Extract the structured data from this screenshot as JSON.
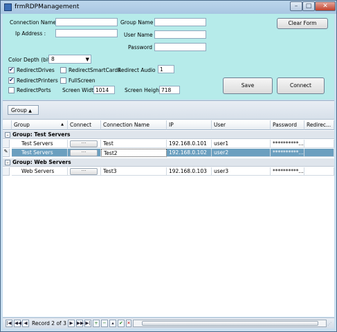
{
  "window": {
    "title": "frmRDPManagement",
    "min_label": "–",
    "max_label": "□",
    "close_label": "✕"
  },
  "form": {
    "connection_name": {
      "label": "Connection Name :",
      "value": ""
    },
    "ip_address": {
      "label": "Ip Address :",
      "value": ""
    },
    "group_name": {
      "label": "Group Name :",
      "value": ""
    },
    "user_name": {
      "label": "User Name :",
      "value": ""
    },
    "password": {
      "label": "Password :",
      "value": ""
    },
    "color_depth": {
      "label": "Color Depth (bit)",
      "value": "8"
    },
    "redirect_audio": {
      "label": "Redirect Audio",
      "value": "1"
    },
    "screen_width": {
      "label": "Screen Width",
      "value": "1014"
    },
    "screen_height": {
      "label": "Screen Height",
      "value": "718"
    },
    "checkboxes": {
      "redirect_drives": {
        "label": "RedirectDrives",
        "checked": true
      },
      "redirect_printers": {
        "label": "RedirectPrinters",
        "checked": true
      },
      "redirect_ports": {
        "label": "RedirectPorts",
        "checked": false
      },
      "redirect_smartcards": {
        "label": "RedirectSmartCards",
        "checked": false
      },
      "full_screen": {
        "label": "FullScreen",
        "checked": false
      }
    },
    "buttons": {
      "clear_form": "Clear Form",
      "save": "Save",
      "connect": "Connect"
    }
  },
  "grid": {
    "group_chip": "Group",
    "group_chip_arrow": "▲",
    "columns": [
      "Group",
      "Connect",
      "Connection Name",
      "IP",
      "User",
      "Password",
      "Redirec..."
    ],
    "sort_arrow": "▲",
    "connect_button_label": "···",
    "groups": [
      {
        "title": "Group: Test Servers",
        "rows": [
          {
            "group": "Test Servers",
            "connection_name": "Test",
            "ip": "192.168.0.101",
            "user": "user1",
            "password": "**********...",
            "selected": false
          },
          {
            "group": "Test Servers",
            "connection_name": "Test2",
            "ip": "192.168.0.102",
            "user": "user2",
            "password": "**********...",
            "selected": true
          }
        ]
      },
      {
        "title": "Group: Web Servers",
        "rows": [
          {
            "group": "Web Servers",
            "connection_name": "Test3",
            "ip": "192.168.0.103",
            "user": "user3",
            "password": "**********...",
            "selected": false
          }
        ]
      }
    ]
  },
  "navigator": {
    "record_text": "Record 2 of 3"
  },
  "colors": {
    "form_bg": "#b6ebea",
    "selected_row": "#6b9fbf"
  }
}
